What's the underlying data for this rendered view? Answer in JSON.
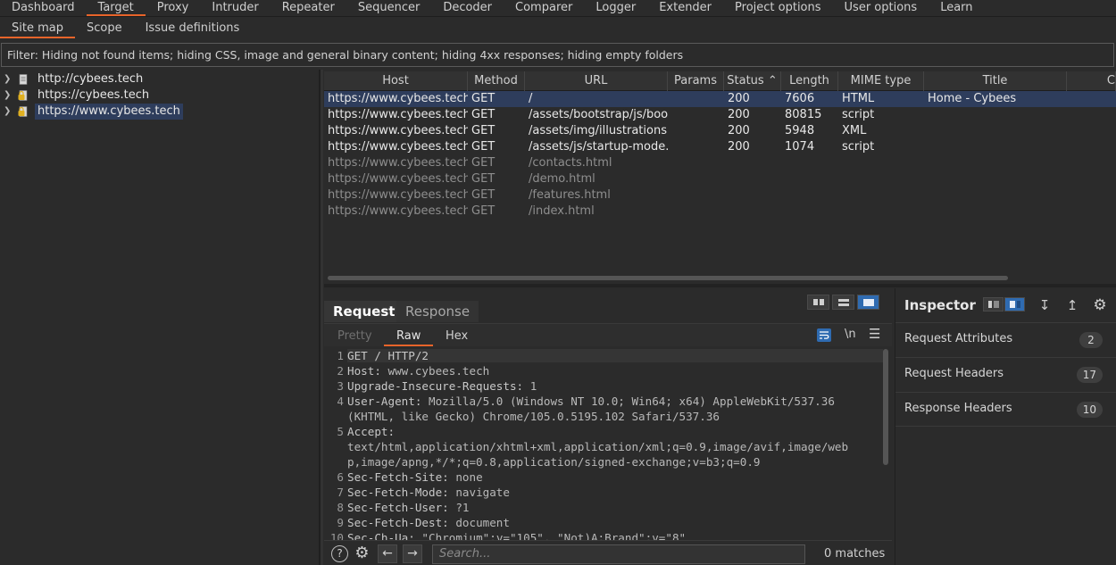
{
  "top_tabs": [
    "Dashboard",
    "Target",
    "Proxy",
    "Intruder",
    "Repeater",
    "Sequencer",
    "Decoder",
    "Comparer",
    "Logger",
    "Extender",
    "Project options",
    "User options",
    "Learn"
  ],
  "sub_tabs": [
    "Site map",
    "Scope",
    "Issue definitions"
  ],
  "filter_text": "Filter: Hiding not found items;  hiding CSS, image and general binary content;  hiding 4xx responses;  hiding empty folders",
  "tree": [
    "http://cybees.tech",
    "https://cybees.tech",
    "https://www.cybees.tech"
  ],
  "table": {
    "columns": [
      "Host",
      "Method",
      "URL",
      "Params",
      "Status",
      "Length",
      "MIME type",
      "Title",
      "C"
    ],
    "rows": [
      [
        "https://www.cybees.tech",
        "GET",
        "/",
        "",
        "200",
        "7606",
        "HTML",
        "Home - Cybees"
      ],
      [
        "https://www.cybees.tech",
        "GET",
        "/assets/bootstrap/js/boo...",
        "",
        "200",
        "80815",
        "script",
        ""
      ],
      [
        "https://www.cybees.tech",
        "GET",
        "/assets/img/illustrations...",
        "",
        "200",
        "5948",
        "XML",
        ""
      ],
      [
        "https://www.cybees.tech",
        "GET",
        "/assets/js/startup-mode...",
        "",
        "200",
        "1074",
        "script",
        ""
      ],
      [
        "https://www.cybees.tech",
        "GET",
        "/contacts.html",
        "",
        "",
        "",
        "",
        ""
      ],
      [
        "https://www.cybees.tech",
        "GET",
        "/demo.html",
        "",
        "",
        "",
        "",
        ""
      ],
      [
        "https://www.cybees.tech",
        "GET",
        "/features.html",
        "",
        "",
        "",
        "",
        ""
      ],
      [
        "https://www.cybees.tech",
        "GET",
        "/index.html",
        "",
        "",
        "",
        "",
        ""
      ]
    ]
  },
  "req": {
    "tab_request": "Request",
    "tab_response": "Response",
    "pretty": "Pretty",
    "raw": "Raw",
    "hex": "Hex",
    "newline_toggle": "\\n",
    "lines": [
      {
        "n": "1",
        "k": "GET / HTTP/2",
        "v": ""
      },
      {
        "n": "2",
        "k": "Host:",
        "v": " www.cybees.tech"
      },
      {
        "n": "3",
        "k": "Upgrade-Insecure-Requests:",
        "v": " 1"
      },
      {
        "n": "4",
        "k": "User-Agent:",
        "v": " Mozilla/5.0 (Windows NT 10.0; Win64; x64) AppleWebKit/537.36"
      },
      {
        "n": "",
        "k": "",
        "v": "(KHTML, like Gecko) Chrome/105.0.5195.102 Safari/537.36"
      },
      {
        "n": "5",
        "k": "Accept:",
        "v": ""
      },
      {
        "n": "",
        "k": "",
        "v": "text/html,application/xhtml+xml,application/xml;q=0.9,image/avif,image/web"
      },
      {
        "n": "",
        "k": "",
        "v": "p,image/apng,*/*;q=0.8,application/signed-exchange;v=b3;q=0.9"
      },
      {
        "n": "6",
        "k": "Sec-Fetch-Site:",
        "v": " none"
      },
      {
        "n": "7",
        "k": "Sec-Fetch-Mode:",
        "v": " navigate"
      },
      {
        "n": "8",
        "k": "Sec-Fetch-User:",
        "v": " ?1"
      },
      {
        "n": "9",
        "k": "Sec-Fetch-Dest:",
        "v": " document"
      },
      {
        "n": "10",
        "k": "Sec-Ch-Ua:",
        "v": " \"Chromium\";v=\"105\", \"Not)A;Brand\";v=\"8\""
      }
    ],
    "search_placeholder": "Search...",
    "matches": "0 matches"
  },
  "inspector": {
    "title": "Inspector",
    "rows": [
      {
        "label": "Request Attributes",
        "count": "2"
      },
      {
        "label": "Request Headers",
        "count": "17"
      },
      {
        "label": "Response Headers",
        "count": "10"
      }
    ]
  },
  "colors": {
    "accent": "#e8642a",
    "selection": "#2e3d5c",
    "toggle_on": "#2f6bb1"
  }
}
